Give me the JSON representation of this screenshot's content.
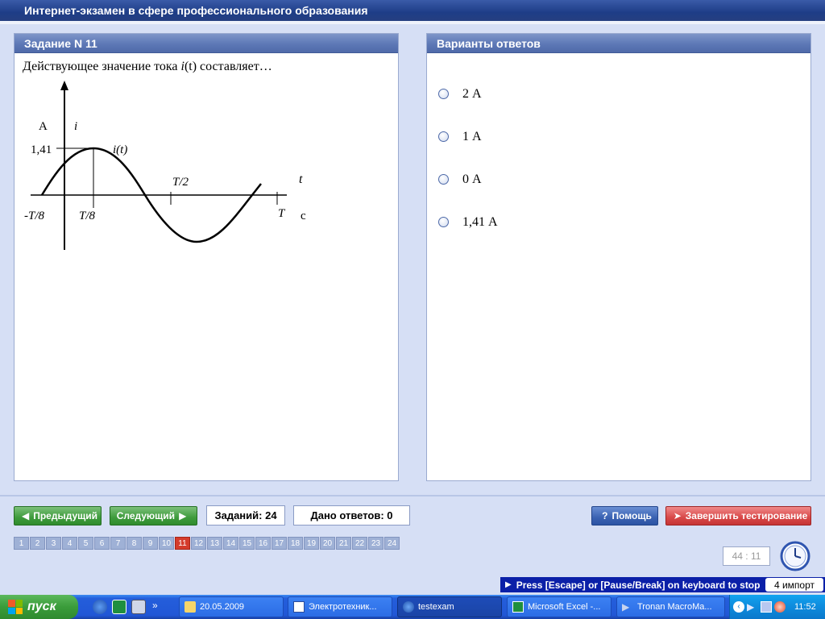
{
  "window": {
    "title": "Интернет-экзамен в сфере профессионального образования"
  },
  "task_panel": {
    "header": "Задание N 11",
    "question_prefix": "Действующее значение тока ",
    "question_func": "i",
    "question_arg": "(t)",
    "question_suffix": " составляет…",
    "graph": {
      "unit_y": "А",
      "axis_y": "i",
      "peak_label": "1,41",
      "curve_label": "i(t)",
      "axis_t": "t",
      "unit_t": "с",
      "tick_neg_t8": "-T/8",
      "tick_t8": "T/8",
      "tick_t2": "T/2",
      "tick_t": "T"
    }
  },
  "answers_panel": {
    "header": "Варианты ответов",
    "options": [
      "2 А",
      "1 А",
      "0 А",
      "1,41 А"
    ]
  },
  "navigation": {
    "prev_label": "Предыдущий",
    "next_label": "Следующий",
    "tasks_count": "Заданий: 24",
    "answers_given": "Дано ответов: 0",
    "help_label": "Помощь",
    "finish_label": "Завершить тестирование"
  },
  "pages": [
    "1",
    "2",
    "3",
    "4",
    "5",
    "6",
    "7",
    "8",
    "9",
    "10",
    "11",
    "12",
    "13",
    "14",
    "15",
    "16",
    "17",
    "18",
    "19",
    "20",
    "21",
    "22",
    "23",
    "24"
  ],
  "current_page": "11",
  "timer": "44 : 11",
  "hint": {
    "text": "Press [Escape] or [Pause/Break] on keyboard to stop",
    "tag": "4 импорт"
  },
  "taskbar": {
    "start_label": "пуск",
    "tasks": [
      "20.05.2009",
      "Электротехник...",
      "testexam",
      "Microsoft Excel -...",
      "Tronan MacroMa..."
    ],
    "clock": "11:52"
  },
  "colors": {
    "accent": "#5d78b6",
    "current_page": "#d43c2c",
    "hint_bar": "#0b20a8",
    "nav_green": "#3e9b3c",
    "finish_red": "#d84848"
  }
}
